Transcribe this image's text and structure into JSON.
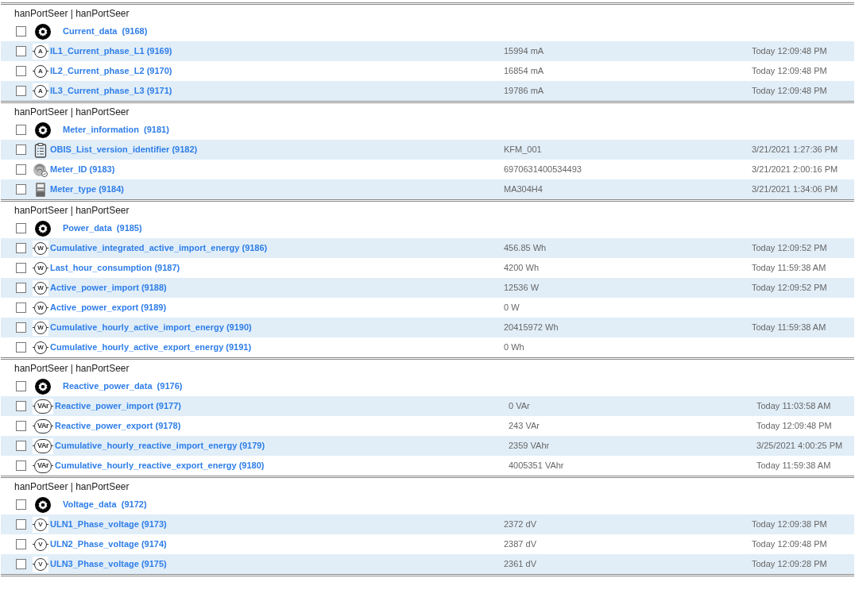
{
  "groups": [
    {
      "header": "hanPortSeer | hanPortSeer",
      "device": {
        "name": "Current_data  (9168)",
        "checked": false
      },
      "rows": [
        {
          "name": "IL1_Current_phase_L1 (9169)",
          "kind": "gauge",
          "icon_label": "A",
          "value": "15994 mA",
          "time": "Today 12:09:48 PM",
          "checked": false
        },
        {
          "name": "IL2_Current_phase_L2 (9170)",
          "kind": "gauge",
          "icon_label": "A",
          "value": "16854 mA",
          "time": "Today 12:09:48 PM",
          "checked": false
        },
        {
          "name": "IL3_Current_phase_L3 (9171)",
          "kind": "gauge",
          "icon_label": "A",
          "value": "19786 mA",
          "time": "Today 12:09:48 PM",
          "checked": false
        }
      ]
    },
    {
      "header": "hanPortSeer | hanPortSeer",
      "device": {
        "name": "Meter_information  (9181)",
        "checked": false
      },
      "rows": [
        {
          "name": "OBIS_List_version_identifier (9182)",
          "kind": "clipboard",
          "value": "KFM_001",
          "time": "3/21/2021 1:27:36 PM",
          "checked": false
        },
        {
          "name": "Meter_ID (9183)",
          "kind": "fingerprint",
          "value": "6970631400534493",
          "time": "3/21/2021 2:00:16 PM",
          "checked": false
        },
        {
          "name": "Meter_type (9184)",
          "kind": "meter",
          "value": "MA304H4",
          "time": "3/21/2021 1:34:06 PM",
          "checked": false
        }
      ]
    },
    {
      "header": "hanPortSeer | hanPortSeer",
      "device": {
        "name": "Power_data  (9185)",
        "checked": false
      },
      "rows": [
        {
          "name": "Cumulative_integrated_active_import_energy (9186)",
          "kind": "gauge",
          "icon_label": "W",
          "value": "456.85 Wh",
          "time": "Today 12:09:52 PM",
          "checked": false
        },
        {
          "name": "Last_hour_consumption (9187)",
          "kind": "gauge",
          "icon_label": "W",
          "value": "4200 Wh",
          "time": "Today 11:59:38 AM",
          "checked": false
        },
        {
          "name": "Active_power_import (9188)",
          "kind": "gauge",
          "icon_label": "W",
          "value": "12536 W",
          "time": "Today 12:09:52 PM",
          "checked": false
        },
        {
          "name": "Active_power_export (9189)",
          "kind": "gauge",
          "icon_label": "W",
          "value": "0 W",
          "checked": false
        },
        {
          "name": "Cumulative_hourly_active_import_energy (9190)",
          "kind": "gauge",
          "icon_label": "W",
          "value": "20415972 Wh",
          "time": "Today 11:59:38 AM",
          "checked": false
        },
        {
          "name": "Cumulative_hourly_active_export_energy (9191)",
          "kind": "gauge",
          "icon_label": "W",
          "value": "0 Wh",
          "checked": false
        }
      ]
    },
    {
      "header": "hanPortSeer | hanPortSeer",
      "device": {
        "name": "Reactive_power_data  (9176)",
        "checked": false
      },
      "rows": [
        {
          "name": "Reactive_power_import (9177)",
          "kind": "gauge",
          "icon_label": "VAr",
          "value": "0 VAr",
          "time": "Today 11:03:58 AM",
          "checked": false
        },
        {
          "name": "Reactive_power_export (9178)",
          "kind": "gauge",
          "icon_label": "VAr",
          "value": "243 VAr",
          "time": "Today 12:09:48 PM",
          "checked": false
        },
        {
          "name": "Cumulative_hourly_reactive_import_energy (9179)",
          "kind": "gauge",
          "icon_label": "VAr",
          "value": "2359 VAhr",
          "time": "3/25/2021 4:00:25 PM",
          "checked": false
        },
        {
          "name": "Cumulative_hourly_reactive_export_energy (9180)",
          "kind": "gauge",
          "icon_label": "VAr",
          "value": "4005351 VAhr",
          "time": "Today 11:59:38 AM",
          "checked": false
        }
      ]
    },
    {
      "header": "hanPortSeer | hanPortSeer",
      "device": {
        "name": "Voltage_data  (9172)",
        "checked": false
      },
      "rows": [
        {
          "name": "ULN1_Phase_voltage (9173)",
          "kind": "gauge",
          "icon_label": "V",
          "value": "2372 dV",
          "time": "Today 12:09:38 PM",
          "checked": false
        },
        {
          "name": "ULN2_Phase_voltage (9174)",
          "kind": "gauge",
          "icon_label": "V",
          "value": "2387 dV",
          "time": "Today 12:09:48 PM",
          "checked": false
        },
        {
          "name": "ULN3_Phase_voltage (9175)",
          "kind": "gauge",
          "icon_label": "V",
          "value": "2361 dV",
          "time": "Today 12:09:28 PM",
          "checked": false
        }
      ]
    }
  ]
}
